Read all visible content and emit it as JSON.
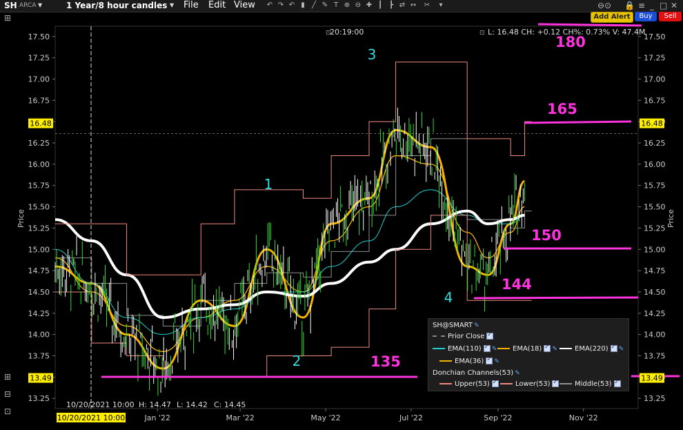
{
  "header": {
    "symbol": "SH",
    "exchange": "ARCA",
    "period": "1 Year/8 hour candles",
    "menu": [
      "File",
      "Edit",
      "View"
    ],
    "add_alert": "Add Alert",
    "buy": "Buy",
    "sell": "Sell"
  },
  "info": {
    "time": "20:19:00",
    "last_line": "L: 16.48 CH: +0.12 CH%: 0.73% V: 47.4M"
  },
  "axis": {
    "ylabel": "Price",
    "yticks": [
      "17.50",
      "17.25",
      "17.00",
      "16.75",
      "16.50",
      "16.25",
      "16.00",
      "15.75",
      "15.50",
      "15.25",
      "15.00",
      "14.75",
      "14.50",
      "14.25",
      "14.00",
      "13.75",
      "13.50",
      "13.25"
    ],
    "xticks": [
      "Jan '22",
      "Mar '22",
      "May '22",
      "Jul '22",
      "Sep '22",
      "Nov '22"
    ],
    "current_price": "16.48",
    "low_marker": "13.49",
    "cursor_date": "10/20/2021 10:00"
  },
  "crosshair": {
    "date": "10/20/2021 10:00",
    "h": "H: 14.47",
    "l": "L: 14.42",
    "c": "C: 14.45"
  },
  "annotations": {
    "waves": [
      "1",
      "2",
      "3",
      "4"
    ],
    "levels": [
      "180",
      "165",
      "150",
      "144",
      "135"
    ]
  },
  "legend": {
    "title": "SH@SMART",
    "prior_close": "Prior Close",
    "ema110": "EMA(110)",
    "ema18": "EMA(18)",
    "ema220": "EMA(220)",
    "ema36": "EMA(36)",
    "donchian": "Donchian Channels(53)",
    "upper": "Upper(53)",
    "lower": "Lower(53)",
    "middle": "Middle(53)"
  },
  "colors": {
    "ema110": "#22d3d3",
    "ema18": "#f5b400",
    "ema220": "#ffffff",
    "ema36": "#f5b400",
    "upper": "#f08a80",
    "lower": "#f08a80",
    "middle": "#909090",
    "annotation": "#ff33dd",
    "wave": "#33dddd"
  },
  "chart_data": {
    "type": "line",
    "x": [
      "2021-10-20",
      "2021-11-15",
      "2021-12-10",
      "2022-01-05",
      "2022-02-01",
      "2022-02-25",
      "2022-03-20",
      "2022-04-15",
      "2022-05-05",
      "2022-06-01",
      "2022-06-20",
      "2022-07-15",
      "2022-08-10",
      "2022-08-25",
      "2022-09-10",
      "2022-09-20"
    ],
    "series": [
      {
        "name": "EMA(18)",
        "values": [
          14.8,
          14.6,
          14.0,
          13.6,
          14.4,
          14.1,
          15.0,
          14.2,
          15.3,
          15.6,
          16.4,
          16.2,
          14.8,
          14.7,
          15.3,
          15.8
        ]
      },
      {
        "name": "EMA(36)",
        "values": [
          14.9,
          14.5,
          14.1,
          13.8,
          14.2,
          14.4,
          14.8,
          14.5,
          15.1,
          15.5,
          16.1,
          16.0,
          15.2,
          14.9,
          15.2,
          15.5
        ]
      },
      {
        "name": "EMA(110)",
        "values": [
          15.0,
          14.6,
          14.2,
          14.0,
          14.2,
          14.3,
          14.5,
          14.5,
          14.8,
          15.1,
          15.5,
          15.7,
          15.4,
          15.3,
          15.3,
          15.4
        ]
      },
      {
        "name": "EMA(220)",
        "values": [
          15.35,
          15.1,
          14.7,
          14.2,
          14.3,
          14.35,
          14.5,
          14.45,
          14.6,
          14.85,
          15.0,
          15.3,
          15.45,
          15.3,
          15.35,
          15.4
        ]
      },
      {
        "name": "Upper(53)",
        "values": [
          15.3,
          15.3,
          14.7,
          14.7,
          15.3,
          15.7,
          15.7,
          15.6,
          16.1,
          16.5,
          17.2,
          17.2,
          16.3,
          16.3,
          16.1,
          16.5
        ]
      },
      {
        "name": "Lower(53)",
        "values": [
          14.5,
          13.9,
          13.75,
          13.5,
          13.5,
          13.5,
          13.75,
          13.75,
          13.85,
          14.3,
          15.0,
          15.4,
          14.4,
          14.4,
          14.4,
          14.4
        ]
      }
    ],
    "ylim": [
      13.13,
      17.62
    ],
    "ylabel": "Price"
  }
}
